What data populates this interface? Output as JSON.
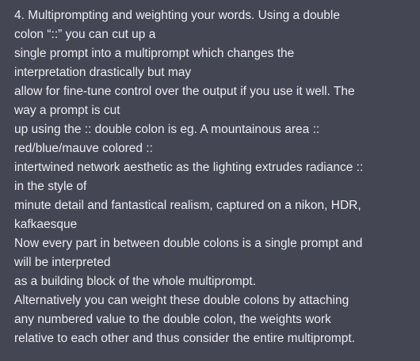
{
  "message": {
    "lines": [
      "4. Multiprompting and weighting your words. Using a double",
      "colon “::” you can cut up a",
      "single prompt into a multiprompt which changes the",
      "interpretation drastically but may",
      "allow for fine-tune control over the output if you use it well. The",
      "way a prompt is cut",
      "up using the :: double colon is eg. A mountainous area ::",
      "red/blue/mauve colored ::",
      "intertwined network aesthetic as the lighting extrudes radiance ::",
      "in the style of",
      "minute detail and fantastical realism, captured on a nikon, HDR,",
      "kafkaesque",
      "Now every part in between double colons is a single prompt and",
      "will be interpreted",
      "as a building block of the whole multiprompt.",
      "Alternatively you can weight these double colons by attaching",
      "any numbered value to the double colon, the weights work",
      "relative to each other and thus consider the entire multiprompt."
    ]
  }
}
